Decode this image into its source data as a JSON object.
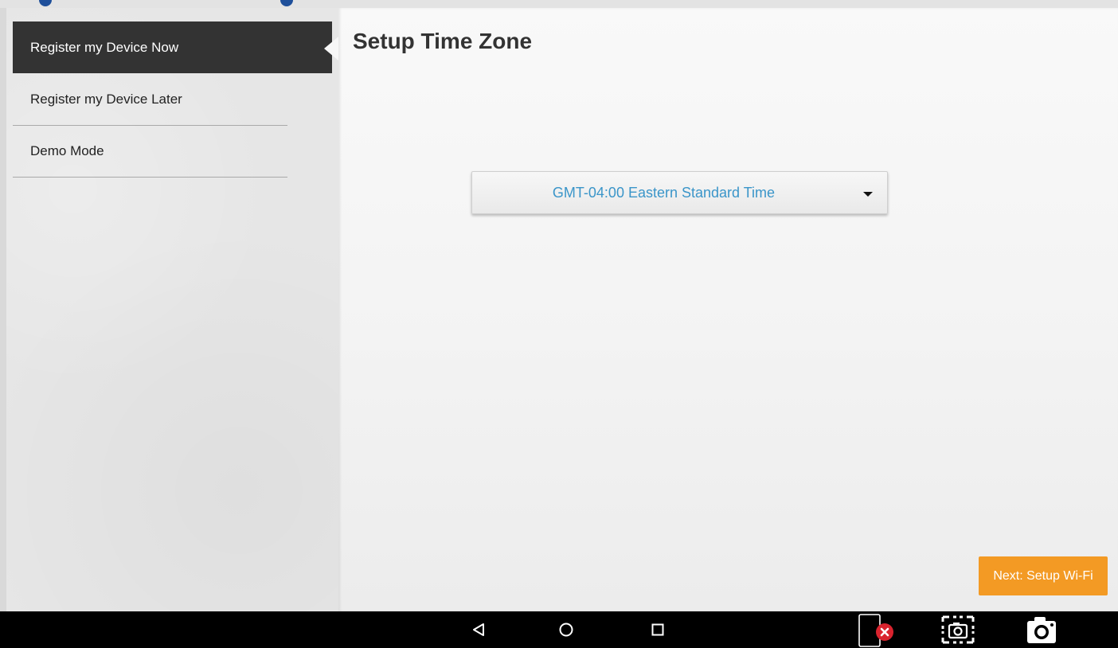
{
  "sidebar": {
    "items": [
      {
        "label": "Register my Device Now",
        "active": true
      },
      {
        "label": "Register my Device Later",
        "active": false
      },
      {
        "label": "Demo Mode",
        "active": false
      }
    ]
  },
  "main": {
    "title": "Setup Time Zone",
    "timezone": {
      "selected": "GMT-04:00 Eastern Standard Time"
    },
    "next_button_label": "Next: Setup Wi-Fi"
  },
  "colors": {
    "active_item_bg": "#333333",
    "timezone_text": "#3a95c9",
    "next_button_bg": "#f39a24",
    "navbar_bg": "#000000",
    "close_badge": "#d9232e"
  },
  "navbar": {
    "icons": [
      "back-icon",
      "home-icon",
      "recents-icon",
      "screen-record-stop-icon",
      "partial-screenshot-icon",
      "camera-icon"
    ]
  }
}
